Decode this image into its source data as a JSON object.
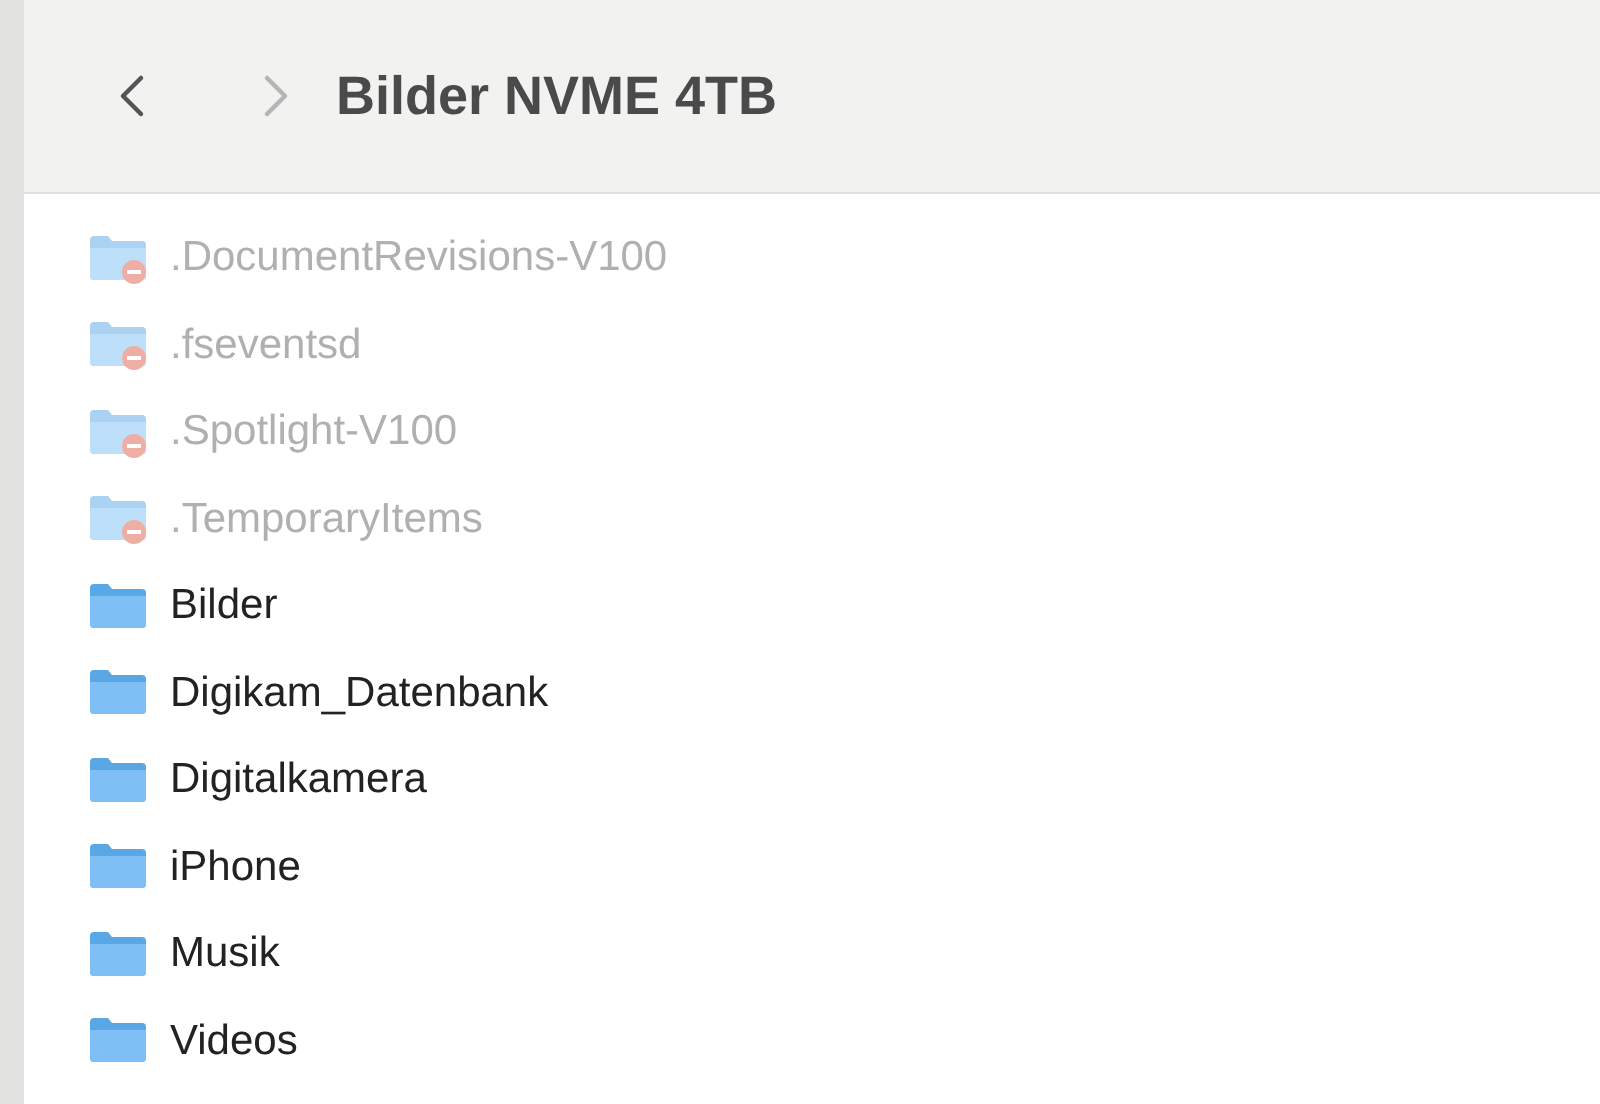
{
  "toolbar": {
    "back": {
      "disabled": false
    },
    "forward": {
      "disabled": true
    },
    "title": "Bilder NVME 4TB"
  },
  "files": [
    {
      "name": ".DocumentRevisions-V100",
      "hidden": true
    },
    {
      "name": ".fseventsd",
      "hidden": true
    },
    {
      "name": ".Spotlight-V100",
      "hidden": true
    },
    {
      "name": ".TemporaryItems",
      "hidden": true
    },
    {
      "name": "Bilder",
      "hidden": false
    },
    {
      "name": "Digikam_Datenbank",
      "hidden": false
    },
    {
      "name": "Digitalkamera",
      "hidden": false
    },
    {
      "name": "iPhone",
      "hidden": false
    },
    {
      "name": "Musik",
      "hidden": false
    },
    {
      "name": "Videos",
      "hidden": false
    }
  ]
}
